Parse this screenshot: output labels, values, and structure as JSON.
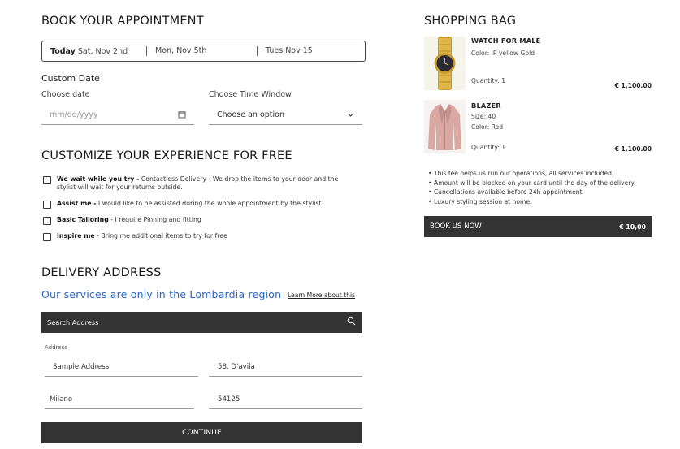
{
  "booking": {
    "title": "BOOK YOUR APPOINTMENT",
    "date_tabs": [
      {
        "bold": "Today",
        "rest": " Sat, Nov 2nd"
      },
      {
        "bold": "",
        "rest": "Mon, Nov 5th"
      },
      {
        "bold": "",
        "rest": "Tues,Nov 15"
      }
    ],
    "custom_date_title": "Custom Date",
    "choose_date_label": "Choose date",
    "date_placeholder": "mm/dd/yyyy",
    "choose_time_label": "Choose Time Window",
    "time_select_value": "Choose an option"
  },
  "customize": {
    "title": "CUSTOMIZE YOUR EXPERIENCE FOR FREE",
    "options": [
      {
        "name": "We wait while you try -",
        "desc": "  Contactless Delivery - We drop the items to your door  and the stylist will wait for your returns outside.",
        "checked": false
      },
      {
        "name": "Assist me -",
        "desc": " I would like to be assisted during the whole appointment by the stylist.",
        "checked": false
      },
      {
        "name": "Basic Tailoring",
        "desc": " - I require Pinning and fitting",
        "checked": false
      },
      {
        "name": "Inspire me",
        "desc": " - Bring me additional items to try for free",
        "checked": false
      }
    ]
  },
  "delivery": {
    "title": "DELIVERY ADDRESS",
    "region_text": "Our services are only in the Lombardia region",
    "learn_more": "Learn More about this",
    "search_placeholder": "Search Address",
    "address_label": "Address",
    "address_line": "Sample Address",
    "street_number": "58, D'avila",
    "city": "Milano",
    "postal_code": "54125",
    "continue_label": "CONTINUE"
  },
  "bag": {
    "title": "SHOPPING BAG",
    "items": [
      {
        "name": "WATCH FOR MALE",
        "details": [
          "Color: IP yellow Gold"
        ],
        "quantity": "Quantity: 1",
        "price": "€ 1,100.00",
        "image_icon": "watch-image"
      },
      {
        "name": "BLAZER",
        "details": [
          "Size: 40",
          "Color: Red"
        ],
        "quantity": "Quantity: 1",
        "price": "€ 1,100.00",
        "image_icon": "blazer-image"
      }
    ],
    "notes": [
      "This fee helps us run our operations, all services included.",
      "Amount will be blocked on your card until the day of the delivery.",
      "Cancellations available before 24h appointment.",
      "Luxury styling session at home."
    ],
    "book_label": "BOOK US NOW",
    "book_price": "€ 10,00"
  },
  "colors": {
    "accent_blue": "#2b66c8",
    "dark_button": "#333333"
  }
}
